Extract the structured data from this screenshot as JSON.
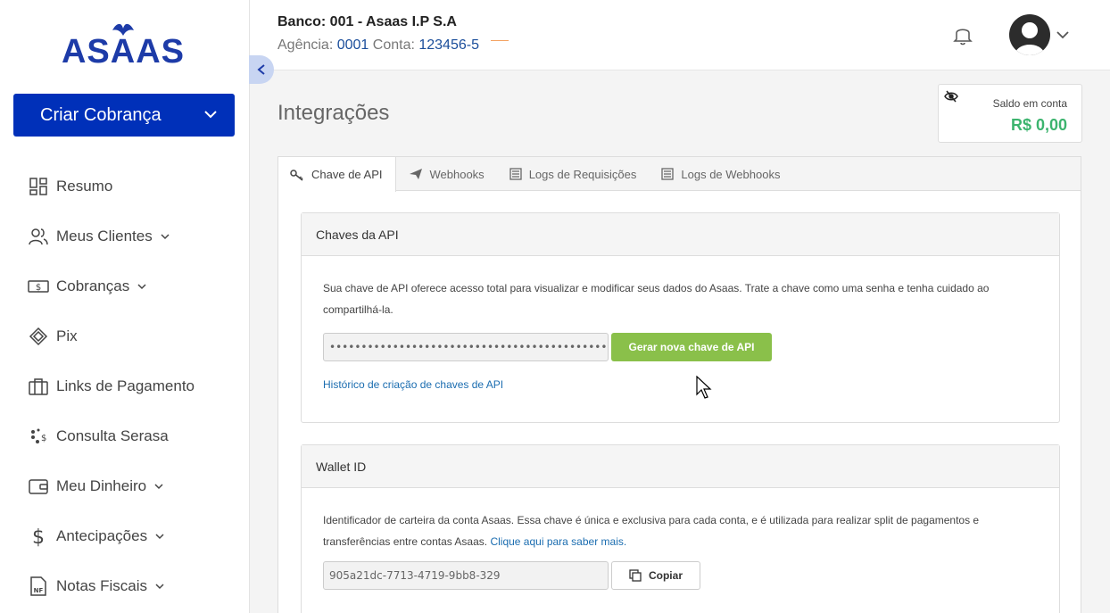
{
  "brand": {
    "logo_text": "ASAAS",
    "color": "#1d3ba8"
  },
  "sidebar": {
    "create_button": "Criar Cobrança",
    "items": [
      {
        "label": "Resumo",
        "icon": "dashboard-icon",
        "has_chevron": false
      },
      {
        "label": "Meus Clientes",
        "icon": "users-icon",
        "has_chevron": true
      },
      {
        "label": "Cobranças",
        "icon": "money-icon",
        "has_chevron": true
      },
      {
        "label": "Pix",
        "icon": "pix-icon",
        "has_chevron": false
      },
      {
        "label": "Links de Pagamento",
        "icon": "briefcase-icon",
        "has_chevron": false
      },
      {
        "label": "Consulta Serasa",
        "icon": "serasa-icon",
        "has_chevron": false
      },
      {
        "label": "Meu Dinheiro",
        "icon": "wallet-icon",
        "has_chevron": true
      },
      {
        "label": "Antecipações",
        "icon": "dollar-icon",
        "has_chevron": true
      },
      {
        "label": "Notas Fiscais",
        "icon": "invoice-icon",
        "has_chevron": true
      }
    ]
  },
  "header": {
    "bank_title": "Banco: 001 - Asaas I.P S.A",
    "agency_label": "Agência:",
    "agency_value": "0001",
    "account_label": "Conta:",
    "account_value": "123456-5"
  },
  "page": {
    "title": "Integrações",
    "balance_label": "Saldo em conta",
    "balance_value": "R$ 0,00"
  },
  "tabs": [
    {
      "label": "Chave de API",
      "icon": "key-icon",
      "active": true
    },
    {
      "label": "Webhooks",
      "icon": "send-icon",
      "active": false
    },
    {
      "label": "Logs de Requisições",
      "icon": "log-icon",
      "active": false
    },
    {
      "label": "Logs de Webhooks",
      "icon": "log-icon",
      "active": false
    }
  ],
  "api_card": {
    "title": "Chaves da API",
    "description": "Sua chave de API oferece acesso total para visualizar e modificar seus dados do Asaas. Trate a chave como uma senha e tenha cuidado ao compartilhá-la.",
    "masked_key": "•••••••••••••••••••••••••••••••••••••••••••••••••••••",
    "generate_button": "Gerar nova chave de API",
    "history_link": "Histórico de criação de chaves de API"
  },
  "wallet_card": {
    "title": "Wallet ID",
    "description": "Identificador de carteira da conta Asaas. Essa chave é única e exclusiva para cada conta, e é utilizada para realizar split de pagamentos e transferências entre contas Asaas.",
    "learn_more": "Clique aqui para saber mais.",
    "wallet_id": "905a21dc-7713-4719-9bb8-329",
    "copy_button": "Copiar"
  }
}
